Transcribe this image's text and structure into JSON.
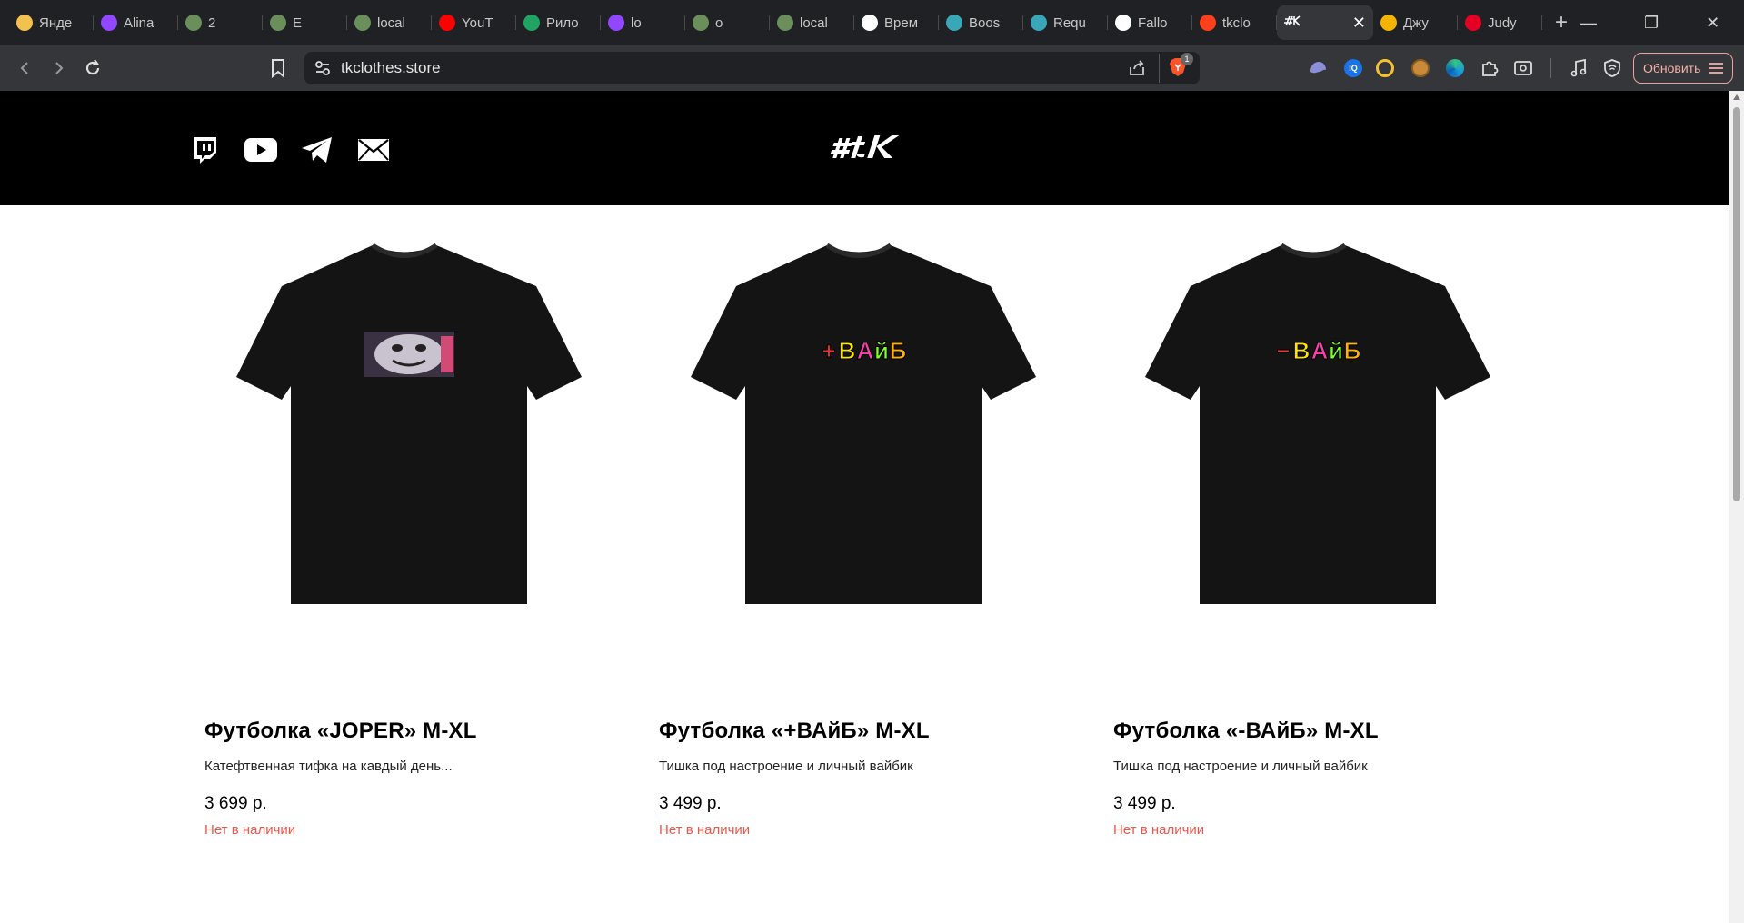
{
  "browser": {
    "tabs": [
      {
        "title": "Янде",
        "color": "#f2c14e"
      },
      {
        "title": "Alina",
        "color": "#9146ff"
      },
      {
        "title": "2",
        "color": "#6a8f5a"
      },
      {
        "title": "E",
        "color": "#6a8f5a"
      },
      {
        "title": "local",
        "color": "#6a8f5a"
      },
      {
        "title": "YouT",
        "color": "#ff0000"
      },
      {
        "title": "Рило",
        "color": "#1fa463"
      },
      {
        "title": "lo",
        "color": "#9146ff"
      },
      {
        "title": "o",
        "color": "#6a8f5a"
      },
      {
        "title": "local",
        "color": "#6a8f5a"
      },
      {
        "title": "Врем",
        "color": "#ffffff"
      },
      {
        "title": "Boos",
        "color": "#3aa6b9"
      },
      {
        "title": "Requ",
        "color": "#3aa6b9"
      },
      {
        "title": "Fallo",
        "color": "#ffffff"
      },
      {
        "title": "tkclo",
        "color": "#fc3f1d"
      },
      {
        "title": "",
        "color": "#ffffff",
        "active": true
      },
      {
        "title": "Джу",
        "color": "#f5b400"
      },
      {
        "title": "Judy",
        "color": "#e60023"
      }
    ],
    "new_tab_label": "+",
    "url": "tkclothes.store",
    "update_label": "Обновить",
    "shields_count": "1"
  },
  "site": {
    "logo_text": "#tK",
    "social": [
      "twitch-icon",
      "youtube-icon",
      "telegram-icon",
      "mail-icon"
    ]
  },
  "products": [
    {
      "name": "Футболка «JOPER» M-XL",
      "description": "Катефтвенная тифка на кавдый день...",
      "price": "3 699 р.",
      "stock": "Нет в наличии",
      "print": "face"
    },
    {
      "name": "Футболка «+ВАйБ» M-XL",
      "description": "Тишка под настроение и личный вайбик",
      "price": "3 499 р.",
      "stock": "Нет в наличии",
      "print": "+ВАйБ"
    },
    {
      "name": "Футболка «-ВАйБ» M-XL",
      "description": "Тишка под настроение и личный вайбик",
      "price": "3 499 р.",
      "stock": "Нет в наличии",
      "print": "–ВАйБ"
    }
  ],
  "colors": {
    "accent_out_of_stock": "#e8584c",
    "header_bg": "#000000"
  }
}
